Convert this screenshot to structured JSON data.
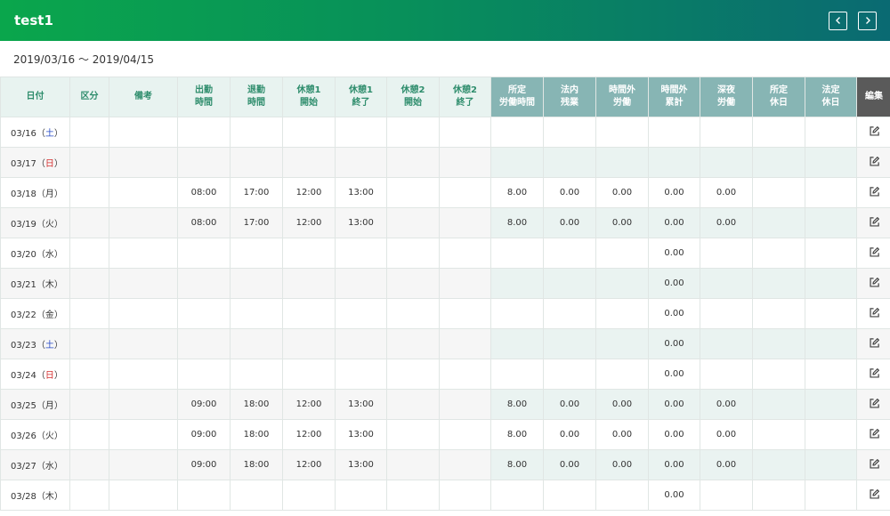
{
  "app": {
    "title": "test1"
  },
  "period": {
    "text": "2019/03/16 ～ 2019/04/15"
  },
  "columns": [
    {
      "line1": "日付",
      "line2": ""
    },
    {
      "line1": "区分",
      "line2": ""
    },
    {
      "line1": "備考",
      "line2": ""
    },
    {
      "line1": "出勤",
      "line2": "時間"
    },
    {
      "line1": "退勤",
      "line2": "時間"
    },
    {
      "line1": "休憩1",
      "line2": "開始"
    },
    {
      "line1": "休憩1",
      "line2": "終了"
    },
    {
      "line1": "休憩2",
      "line2": "開始"
    },
    {
      "line1": "休憩2",
      "line2": "終了"
    },
    {
      "line1": "所定",
      "line2": "労働時間"
    },
    {
      "line1": "法内",
      "line2": "残業"
    },
    {
      "line1": "時間外",
      "line2": "労働"
    },
    {
      "line1": "時間外",
      "line2": "累計"
    },
    {
      "line1": "深夜",
      "line2": "労働"
    },
    {
      "line1": "所定",
      "line2": "休日"
    },
    {
      "line1": "法定",
      "line2": "休日"
    },
    {
      "line1": "編集",
      "line2": ""
    }
  ],
  "rows": [
    {
      "date": "03/16",
      "open": "（",
      "day": "土",
      "close": "）",
      "day_type": "sat",
      "kubun": "",
      "biko": "",
      "in": "",
      "out": "",
      "b1s": "",
      "b1e": "",
      "b2s": "",
      "b2e": "",
      "shotei": "",
      "hounai": "",
      "jikangai": "",
      "ruikei": "",
      "shinya": "",
      "shotei_kyujitsu": "",
      "houtei_kyujitsu": ""
    },
    {
      "date": "03/17",
      "open": "（",
      "day": "日",
      "close": "）",
      "day_type": "sun",
      "kubun": "",
      "biko": "",
      "in": "",
      "out": "",
      "b1s": "",
      "b1e": "",
      "b2s": "",
      "b2e": "",
      "shotei": "",
      "hounai": "",
      "jikangai": "",
      "ruikei": "",
      "shinya": "",
      "shotei_kyujitsu": "",
      "houtei_kyujitsu": ""
    },
    {
      "date": "03/18",
      "open": "（",
      "day": "月",
      "close": "）",
      "day_type": "",
      "kubun": "",
      "biko": "",
      "in": "08:00",
      "out": "17:00",
      "b1s": "12:00",
      "b1e": "13:00",
      "b2s": "",
      "b2e": "",
      "shotei": "8.00",
      "hounai": "0.00",
      "jikangai": "0.00",
      "ruikei": "0.00",
      "shinya": "0.00",
      "shotei_kyujitsu": "",
      "houtei_kyujitsu": ""
    },
    {
      "date": "03/19",
      "open": "（",
      "day": "火",
      "close": "）",
      "day_type": "",
      "kubun": "",
      "biko": "",
      "in": "08:00",
      "out": "17:00",
      "b1s": "12:00",
      "b1e": "13:00",
      "b2s": "",
      "b2e": "",
      "shotei": "8.00",
      "hounai": "0.00",
      "jikangai": "0.00",
      "ruikei": "0.00",
      "shinya": "0.00",
      "shotei_kyujitsu": "",
      "houtei_kyujitsu": ""
    },
    {
      "date": "03/20",
      "open": "（",
      "day": "水",
      "close": "）",
      "day_type": "",
      "kubun": "",
      "biko": "",
      "in": "",
      "out": "",
      "b1s": "",
      "b1e": "",
      "b2s": "",
      "b2e": "",
      "shotei": "",
      "hounai": "",
      "jikangai": "",
      "ruikei": "0.00",
      "shinya": "",
      "shotei_kyujitsu": "",
      "houtei_kyujitsu": ""
    },
    {
      "date": "03/21",
      "open": "（",
      "day": "木",
      "close": "）",
      "day_type": "",
      "kubun": "",
      "biko": "",
      "in": "",
      "out": "",
      "b1s": "",
      "b1e": "",
      "b2s": "",
      "b2e": "",
      "shotei": "",
      "hounai": "",
      "jikangai": "",
      "ruikei": "0.00",
      "shinya": "",
      "shotei_kyujitsu": "",
      "houtei_kyujitsu": ""
    },
    {
      "date": "03/22",
      "open": "（",
      "day": "金",
      "close": "）",
      "day_type": "",
      "kubun": "",
      "biko": "",
      "in": "",
      "out": "",
      "b1s": "",
      "b1e": "",
      "b2s": "",
      "b2e": "",
      "shotei": "",
      "hounai": "",
      "jikangai": "",
      "ruikei": "0.00",
      "shinya": "",
      "shotei_kyujitsu": "",
      "houtei_kyujitsu": ""
    },
    {
      "date": "03/23",
      "open": "（",
      "day": "土",
      "close": "）",
      "day_type": "sat",
      "kubun": "",
      "biko": "",
      "in": "",
      "out": "",
      "b1s": "",
      "b1e": "",
      "b2s": "",
      "b2e": "",
      "shotei": "",
      "hounai": "",
      "jikangai": "",
      "ruikei": "0.00",
      "shinya": "",
      "shotei_kyujitsu": "",
      "houtei_kyujitsu": ""
    },
    {
      "date": "03/24",
      "open": "（",
      "day": "日",
      "close": "）",
      "day_type": "sun",
      "kubun": "",
      "biko": "",
      "in": "",
      "out": "",
      "b1s": "",
      "b1e": "",
      "b2s": "",
      "b2e": "",
      "shotei": "",
      "hounai": "",
      "jikangai": "",
      "ruikei": "0.00",
      "shinya": "",
      "shotei_kyujitsu": "",
      "houtei_kyujitsu": ""
    },
    {
      "date": "03/25",
      "open": "（",
      "day": "月",
      "close": "）",
      "day_type": "",
      "kubun": "",
      "biko": "",
      "in": "09:00",
      "out": "18:00",
      "b1s": "12:00",
      "b1e": "13:00",
      "b2s": "",
      "b2e": "",
      "shotei": "8.00",
      "hounai": "0.00",
      "jikangai": "0.00",
      "ruikei": "0.00",
      "shinya": "0.00",
      "shotei_kyujitsu": "",
      "houtei_kyujitsu": ""
    },
    {
      "date": "03/26",
      "open": "（",
      "day": "火",
      "close": "）",
      "day_type": "",
      "kubun": "",
      "biko": "",
      "in": "09:00",
      "out": "18:00",
      "b1s": "12:00",
      "b1e": "13:00",
      "b2s": "",
      "b2e": "",
      "shotei": "8.00",
      "hounai": "0.00",
      "jikangai": "0.00",
      "ruikei": "0.00",
      "shinya": "0.00",
      "shotei_kyujitsu": "",
      "houtei_kyujitsu": ""
    },
    {
      "date": "03/27",
      "open": "（",
      "day": "水",
      "close": "）",
      "day_type": "",
      "kubun": "",
      "biko": "",
      "in": "09:00",
      "out": "18:00",
      "b1s": "12:00",
      "b1e": "13:00",
      "b2s": "",
      "b2e": "",
      "shotei": "8.00",
      "hounai": "0.00",
      "jikangai": "0.00",
      "ruikei": "0.00",
      "shinya": "0.00",
      "shotei_kyujitsu": "",
      "houtei_kyujitsu": ""
    },
    {
      "date": "03/28",
      "open": "（",
      "day": "木",
      "close": "）",
      "day_type": "",
      "kubun": "",
      "biko": "",
      "in": "",
      "out": "",
      "b1s": "",
      "b1e": "",
      "b2s": "",
      "b2e": "",
      "shotei": "",
      "hounai": "",
      "jikangai": "",
      "ruikei": "0.00",
      "shinya": "",
      "shotei_kyujitsu": "",
      "houtei_kyujitsu": ""
    }
  ],
  "icons": {
    "prev": "chevron-left-icon",
    "next": "chevron-right-icon",
    "edit": "edit-icon"
  },
  "colors": {
    "saturday": "#2a4dc7",
    "sunday": "#d42f2f",
    "header_accent": "#87b5b4",
    "edit_header": "#5a5a5a"
  }
}
